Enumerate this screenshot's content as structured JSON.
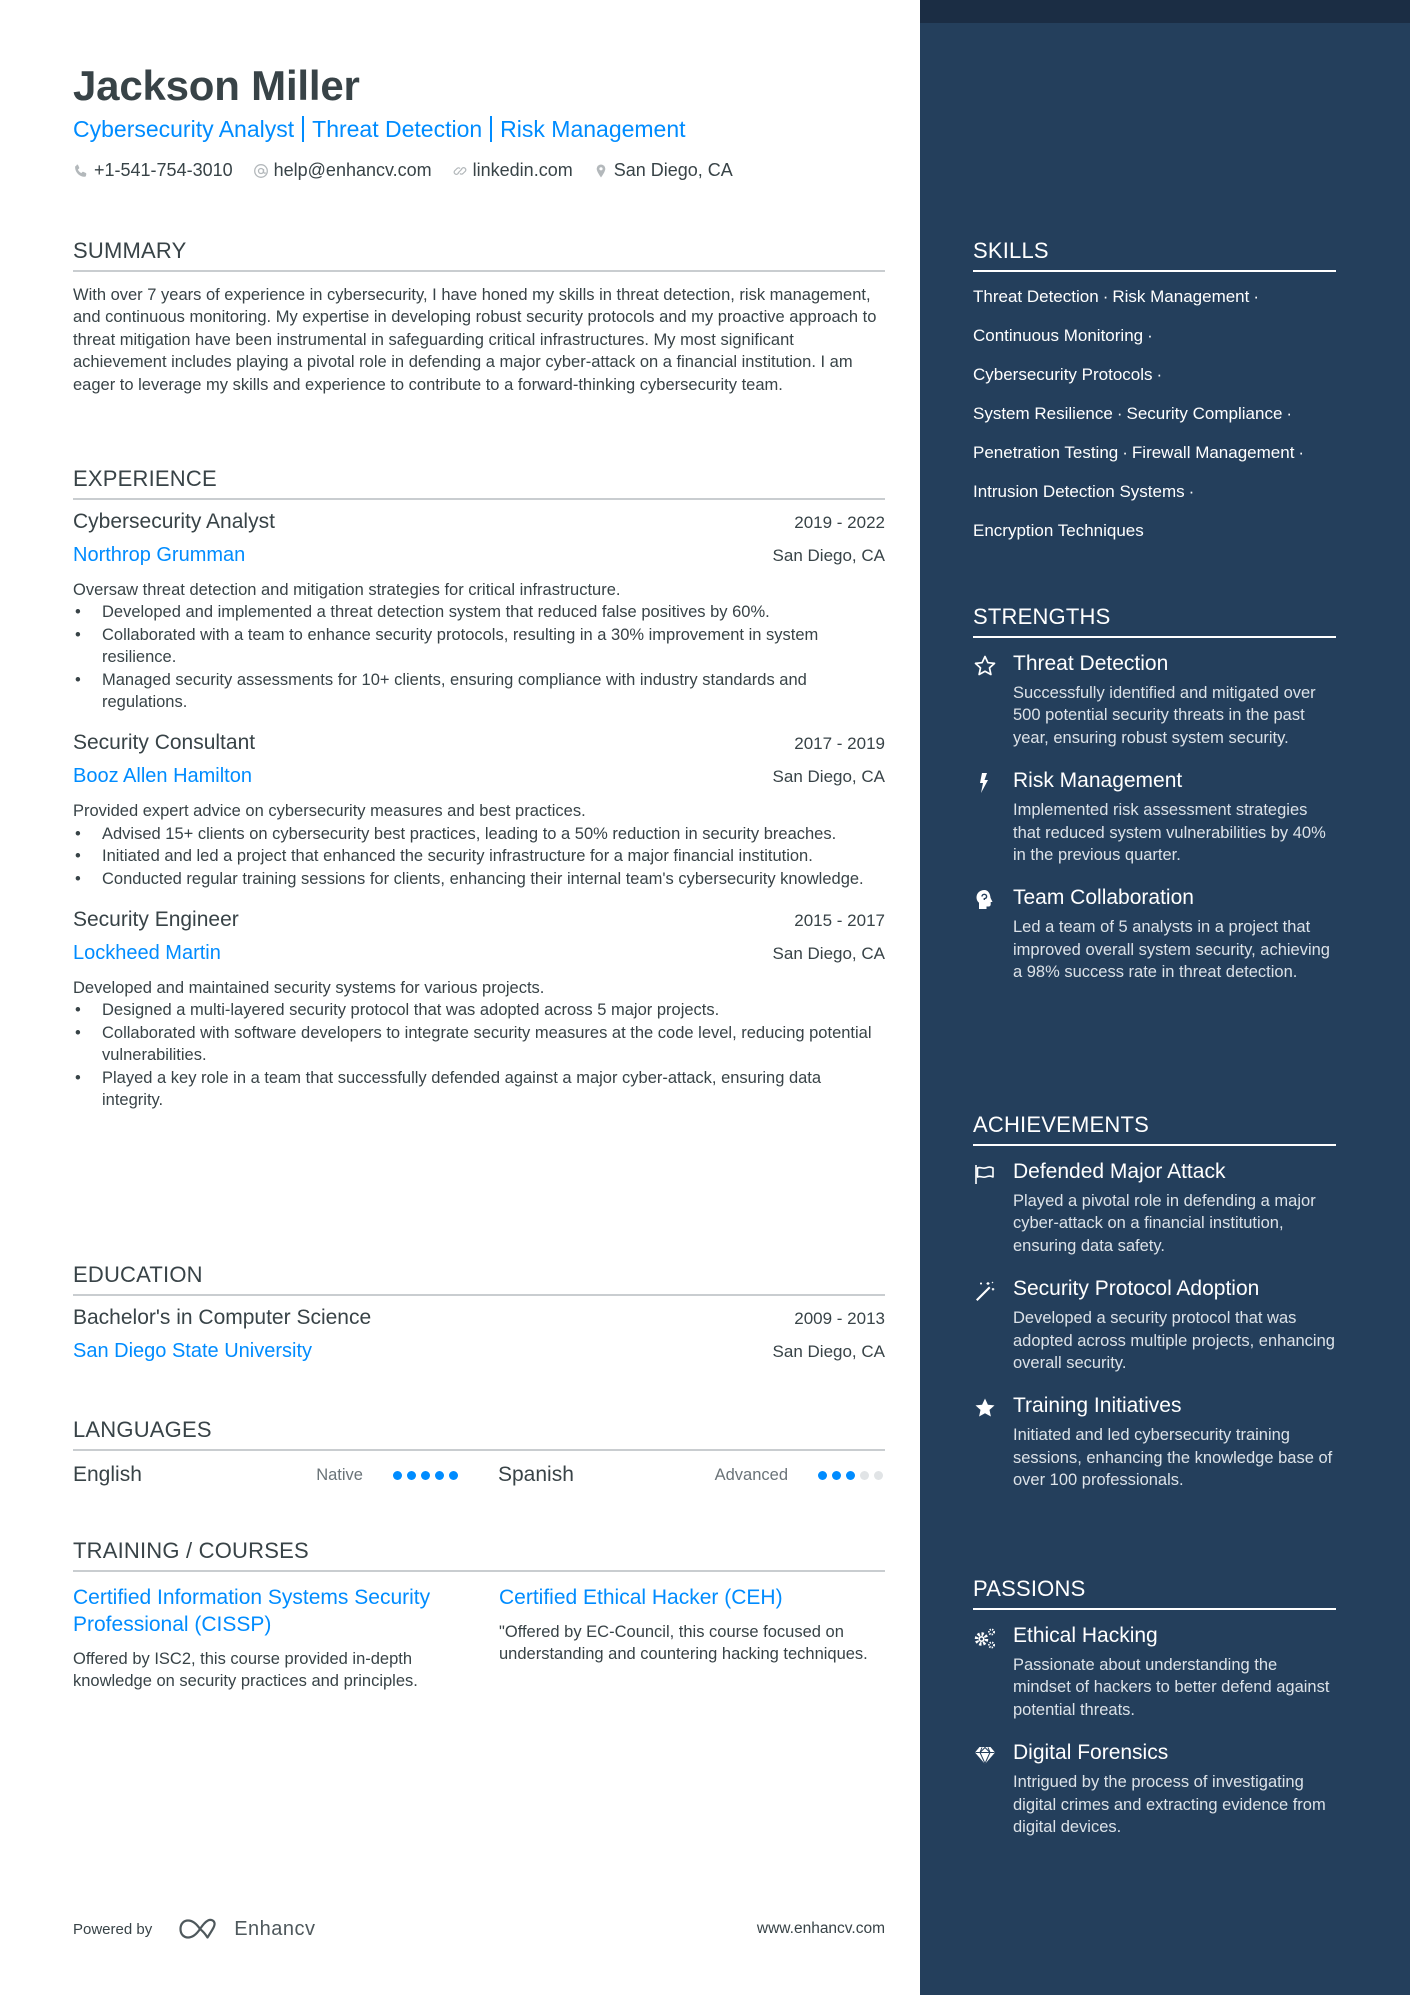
{
  "header": {
    "name": "Jackson Miller",
    "title_parts": [
      "Cybersecurity Analyst",
      "Threat Detection",
      "Risk Management"
    ],
    "contacts": {
      "phone": "+1-541-754-3010",
      "email": "help@enhancv.com",
      "website": "linkedin.com",
      "location": "San Diego, CA"
    }
  },
  "colors": {
    "accent": "#008cff",
    "text": "#384347",
    "sidebar_bg": "#243f5c",
    "sidebar_band": "#1b2d44",
    "dot_inactive": "#e1e4e6"
  },
  "summary": {
    "title": "Summary",
    "text": "With over 7 years of experience in cybersecurity, I have honed my skills in threat detection, risk management, and continuous monitoring. My expertise in developing robust security protocols and my proactive approach to threat mitigation have been instrumental in safeguarding critical infrastructures. My most significant achievement includes playing a pivotal role in defending a major cyber-attack on a financial institution. I am eager to leverage my skills and experience to contribute to a forward-thinking cybersecurity team."
  },
  "experience": {
    "title": "Experience",
    "jobs": [
      {
        "title": "Cybersecurity Analyst",
        "dates": "2019 - 2022",
        "company": "Northrop Grumman",
        "location": "San Diego, CA",
        "description": "Oversaw threat detection and mitigation strategies for critical infrastructure.",
        "bullets": [
          "Developed and implemented a threat detection system that reduced false positives by 60%.",
          "Collaborated with a team to enhance security protocols, resulting in a 30% improvement in system resilience.",
          "Managed security assessments for 10+ clients, ensuring compliance with industry standards and regulations."
        ]
      },
      {
        "title": "Security Consultant",
        "dates": "2017 - 2019",
        "company": "Booz Allen Hamilton",
        "location": "San Diego, CA",
        "description": "Provided expert advice on cybersecurity measures and best practices.",
        "bullets": [
          "Advised 15+ clients on cybersecurity best practices, leading to a 50% reduction in security breaches.",
          "Initiated and led a project that enhanced the security infrastructure for a major financial institution.",
          "Conducted regular training sessions for clients, enhancing their internal team's cybersecurity knowledge."
        ]
      },
      {
        "title": "Security Engineer",
        "dates": "2015 - 2017",
        "company": "Lockheed Martin",
        "location": "San Diego, CA",
        "description": "Developed and maintained security systems for various projects.",
        "bullets": [
          "Designed a multi-layered security protocol that was adopted across 5 major projects.",
          "Collaborated with software developers to integrate security measures at the code level, reducing potential vulnerabilities.",
          "Played a key role in a team that successfully defended against a major cyber-attack, ensuring data integrity."
        ]
      }
    ]
  },
  "education": {
    "title": "Education",
    "degree": "Bachelor's in Computer Science",
    "dates": "2009 - 2013",
    "school": "San Diego State University",
    "location": "San Diego, CA"
  },
  "languages": {
    "title": "Languages",
    "items": [
      {
        "name": "English",
        "level": "Native",
        "rating": 5,
        "max": 5
      },
      {
        "name": "Spanish",
        "level": "Advanced",
        "rating": 3,
        "max": 5
      }
    ]
  },
  "training": {
    "title": "Training / Courses",
    "items": [
      {
        "title": "Certified Information Systems Security Professional (CISSP)",
        "description": "Offered by ISC2, this course provided in-depth knowledge on security practices and principles."
      },
      {
        "title": "Certified Ethical Hacker (CEH)",
        "description": "\"Offered by EC-Council, this course focused on understanding and countering hacking techniques."
      }
    ]
  },
  "footer": {
    "powered_by": "Powered by",
    "brand": "Enhancv",
    "website": "www.enhancv.com"
  },
  "skills": {
    "title": "Skills",
    "lines": [
      [
        "Threat Detection",
        "Risk Management"
      ],
      [
        "Continuous Monitoring"
      ],
      [
        "Cybersecurity Protocols"
      ],
      [
        "System Resilience",
        "Security Compliance"
      ],
      [
        "Penetration Testing",
        "Firewall Management"
      ],
      [
        "Intrusion Detection Systems"
      ],
      [
        "Encryption Techniques"
      ]
    ],
    "separator": "·"
  },
  "strengths": {
    "title": "Strengths",
    "items": [
      {
        "icon": "star-outline-icon",
        "title": "Threat Detection",
        "description": "Successfully identified and mitigated over 500 potential security threats in the past year, ensuring robust system security."
      },
      {
        "icon": "lightning-icon",
        "title": "Risk Management",
        "description": "Implemented risk assessment strategies that reduced system vulnerabilities by 40% in the previous quarter."
      },
      {
        "icon": "head-brain-icon",
        "title": "Team Collaboration",
        "description": "Led a team of 5 analysts in a project that improved overall system security, achieving a 98% success rate in threat detection."
      }
    ]
  },
  "achievements": {
    "title": "Achievements",
    "items": [
      {
        "icon": "flag-icon",
        "title": "Defended Major Attack",
        "description": "Played a pivotal role in defending a major cyber-attack on a financial institution, ensuring data safety."
      },
      {
        "icon": "magic-wand-icon",
        "title": "Security Protocol Adoption",
        "description": "Developed a security protocol that was adopted across multiple projects, enhancing overall security."
      },
      {
        "icon": "star-filled-icon",
        "title": "Training Initiatives",
        "description": "Initiated and led cybersecurity training sessions, enhancing the knowledge base of over 100 professionals."
      }
    ]
  },
  "passions": {
    "title": "Passions",
    "items": [
      {
        "icon": "gears-icon",
        "title": "Ethical Hacking",
        "description": "Passionate about understanding the mindset of hackers to better defend against potential threats."
      },
      {
        "icon": "diamond-icon",
        "title": "Digital Forensics",
        "description": "Intrigued by the process of investigating digital crimes and extracting evidence from digital devices."
      }
    ]
  }
}
